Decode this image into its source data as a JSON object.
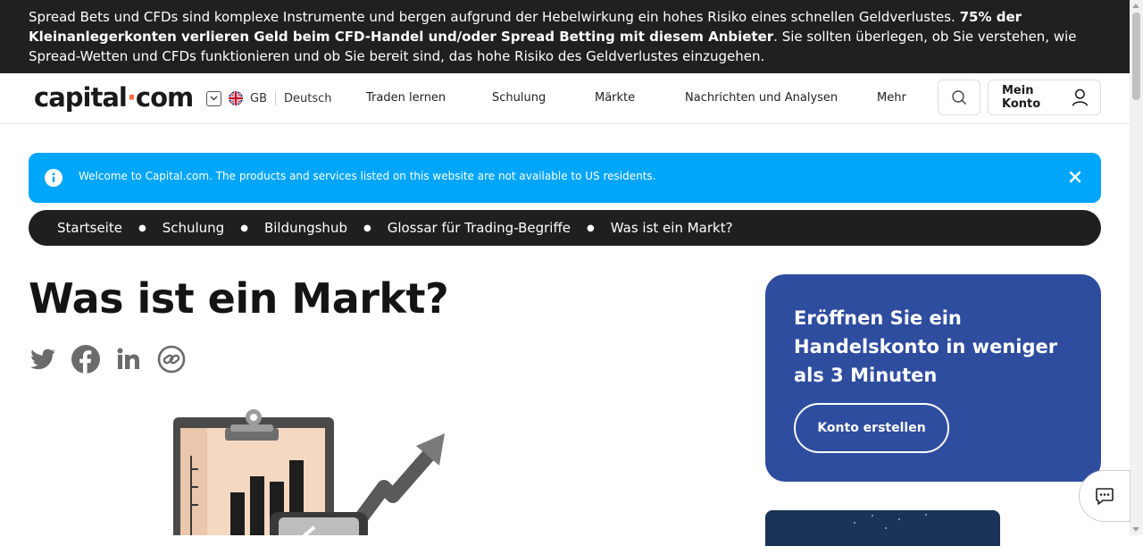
{
  "risk_banner": {
    "text_1": "Spread Bets und CFDs sind komplexe Instrumente und bergen aufgrund der Hebelwirkung ein hohes Risiko eines schnellen Geldverlustes. ",
    "bold": "75% der Kleinanlegerkonten verlieren Geld beim CFD-Handel und/oder Spread Betting mit diesem Anbieter",
    "text_2": ". Sie sollten überlegen, ob Sie verstehen, wie Spread-Wetten und CFDs funktionieren und ob Sie bereit sind, das hohe Risiko des Geldverlustes einzugehen."
  },
  "header": {
    "logo_left": "capital",
    "logo_dot": "·",
    "logo_right": "com",
    "region": "GB",
    "language": "Deutsch",
    "nav": [
      "Traden lernen",
      "Schulung",
      "Märkte",
      "Nachrichten und Analysen",
      "Mehr"
    ],
    "account_label": "Mein Konto"
  },
  "notice": {
    "text": "Welcome to Capital.com. The products and services listed on this website are not available to US residents."
  },
  "breadcrumb": [
    "Startseite",
    "Schulung",
    "Bildungshub",
    "Glossar für Trading-Begriffe",
    "Was ist ein Markt?"
  ],
  "page": {
    "title": "Was ist ein Markt?"
  },
  "promo": {
    "title": "Eröffnen Sie ein Handelskonto in weniger als 3 Minuten",
    "button": "Konto erstellen"
  },
  "colors": {
    "banner_bg": "#202020",
    "notice_bg": "#00a6f9",
    "breadcrumb_bg": "#1f1f1f",
    "promo_bg": "#2f4d9f",
    "accent": "#ff6a3a"
  },
  "icons": [
    "chevron-down-icon",
    "uk-flag-icon",
    "search-icon",
    "user-icon",
    "info-icon",
    "close-icon",
    "twitter-icon",
    "facebook-icon",
    "linkedin-icon",
    "link-icon",
    "chat-icon"
  ]
}
